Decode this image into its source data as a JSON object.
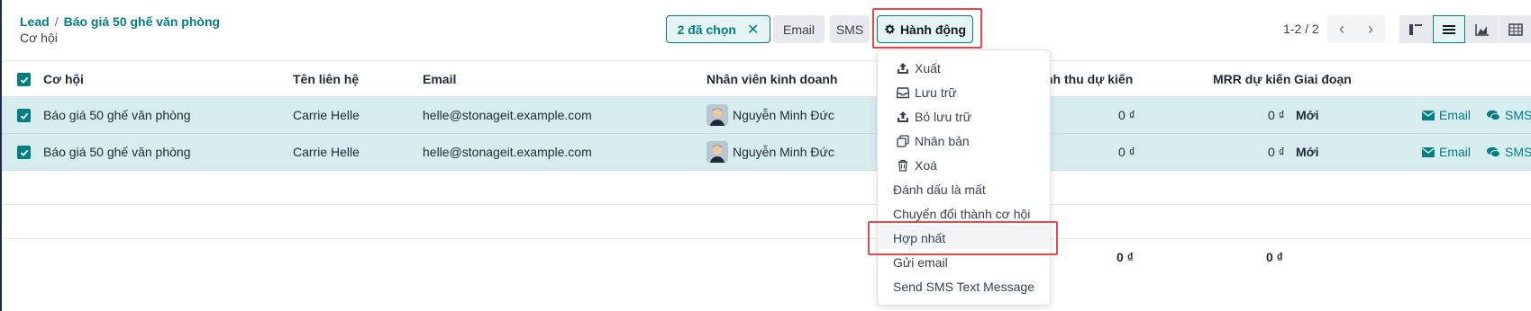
{
  "breadcrumb": {
    "parent": "Lead",
    "current": "Báo giá 50 ghế văn phòng",
    "sub": "Cơ hội"
  },
  "selection": {
    "label": "2 đã chọn"
  },
  "toolbar": {
    "email": "Email",
    "sms": "SMS",
    "action": "Hành động"
  },
  "pager": {
    "text": "1-2 / 2"
  },
  "columns": [
    "Cơ hội",
    "Tên liên hệ",
    "Email",
    "Nhân viên kinh doanh",
    "nh thu dự kiến",
    "MRR dự kiến",
    "Giai đoạn"
  ],
  "rows": [
    {
      "opportunity": "Báo giá 50 ghế văn phòng",
      "contact": "Carrie Helle",
      "email": "helle@stonageit.example.com",
      "salesperson": "Nguyễn Minh Đức",
      "revenue": "0 ₫",
      "mrr": "0 ₫",
      "stage": "Mới",
      "email_action": "Email",
      "sms_action": "SMS"
    },
    {
      "opportunity": "Báo giá 50 ghế văn phòng",
      "contact": "Carrie Helle",
      "email": "helle@stonageit.example.com",
      "salesperson": "Nguyễn Minh Đức",
      "revenue": "0 ₫",
      "mrr": "0 ₫",
      "stage": "Mới",
      "email_action": "Email",
      "sms_action": "SMS"
    }
  ],
  "totals": {
    "revenue": "0 ₫",
    "mrr": "0 ₫"
  },
  "menu": {
    "export": "Xuất",
    "archive": "Lưu trữ",
    "unarchive": "Bỏ lưu trữ",
    "duplicate": "Nhân bản",
    "delete": "Xoá",
    "mark_lost": "Đánh dấu là mất",
    "convert": "Chuyển đổi thành cơ hội",
    "merge": "Hợp nhất",
    "send_email": "Gửi email",
    "send_sms": "Send SMS Text Message"
  },
  "colors": {
    "accent": "#017e84",
    "highlight": "#e5484d",
    "selected_row": "#d7ecee"
  }
}
